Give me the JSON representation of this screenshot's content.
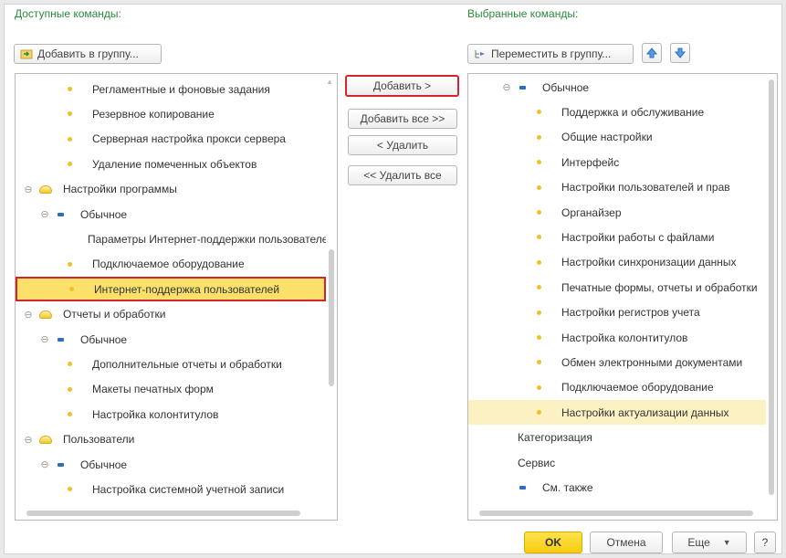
{
  "left": {
    "title": "Доступные команды:",
    "add_to_group": "Добавить в группу...",
    "rows": [
      {
        "level": 2,
        "icon": "dot",
        "label": "Регламентные и фоновые задания"
      },
      {
        "level": 2,
        "icon": "dot",
        "label": "Резервное копирование"
      },
      {
        "level": 2,
        "icon": "dot",
        "label": "Серверная настройка прокси сервера"
      },
      {
        "level": 2,
        "icon": "dot",
        "label": "Удаление помеченных объектов"
      },
      {
        "level": 0,
        "icon": "folder",
        "expander": "⊖",
        "label": "Настройки программы"
      },
      {
        "level": 1,
        "icon": "dash",
        "expander": "⊖",
        "label": "Обычное"
      },
      {
        "level": 2,
        "icon": "dot",
        "label": "Параметры Интернет-поддержки пользователей"
      },
      {
        "level": 2,
        "icon": "dot",
        "label": "Подключаемое оборудование"
      },
      {
        "level": 2,
        "icon": "dot",
        "label": "Интернет-поддержка пользователей",
        "state": "selected-box"
      },
      {
        "level": 0,
        "icon": "folder",
        "expander": "⊖",
        "label": "Отчеты и обработки"
      },
      {
        "level": 1,
        "icon": "dash",
        "expander": "⊖",
        "label": "Обычное"
      },
      {
        "level": 2,
        "icon": "dot",
        "label": "Дополнительные отчеты и обработки"
      },
      {
        "level": 2,
        "icon": "dot",
        "label": "Макеты печатных форм"
      },
      {
        "level": 2,
        "icon": "dot",
        "label": "Настройка колонтитулов"
      },
      {
        "level": 0,
        "icon": "folder",
        "expander": "⊖",
        "label": "Пользователи"
      },
      {
        "level": 1,
        "icon": "dash",
        "expander": "⊖",
        "label": "Обычное"
      },
      {
        "level": 2,
        "icon": "dot",
        "label": "Настройка системной учетной записи"
      }
    ]
  },
  "middle": {
    "add": "Добавить >",
    "add_all": "Добавить все >>",
    "remove": "< Удалить",
    "remove_all": "<< Удалить все"
  },
  "right": {
    "title": "Выбранные команды:",
    "move_to_group": "Переместить в группу...",
    "rows": [
      {
        "level": 1,
        "icon": "dash",
        "expander": "⊖",
        "label": "Обычное"
      },
      {
        "level": 2,
        "icon": "dot",
        "label": "Поддержка и обслуживание"
      },
      {
        "level": 2,
        "icon": "dot",
        "label": "Общие настройки"
      },
      {
        "level": 2,
        "icon": "dot",
        "label": "Интерфейс"
      },
      {
        "level": 2,
        "icon": "dot",
        "label": "Настройки пользователей и прав"
      },
      {
        "level": 2,
        "icon": "dot",
        "label": "Органайзер"
      },
      {
        "level": 2,
        "icon": "dot",
        "label": "Настройки работы с файлами"
      },
      {
        "level": 2,
        "icon": "dot",
        "label": "Настройки синхронизации данных"
      },
      {
        "level": 2,
        "icon": "dot",
        "label": "Печатные формы, отчеты и обработки"
      },
      {
        "level": 2,
        "icon": "dot",
        "label": "Настройки регистров учета"
      },
      {
        "level": 2,
        "icon": "dot",
        "label": "Настройка колонтитулов"
      },
      {
        "level": 2,
        "icon": "dot",
        "label": "Обмен электронными документами"
      },
      {
        "level": 2,
        "icon": "dot",
        "label": "Подключаемое оборудование"
      },
      {
        "level": 2,
        "icon": "dot",
        "label": "Настройки актуализации данных",
        "state": "light"
      },
      {
        "level": 0,
        "icon": "none",
        "label": "Категоризация"
      },
      {
        "level": 0,
        "icon": "none",
        "label": "Сервис"
      },
      {
        "level": 0,
        "icon": "dash",
        "label": "См. также"
      }
    ]
  },
  "footer": {
    "ok": "OK",
    "cancel": "Отмена",
    "more": "Еще",
    "help": "?"
  },
  "colors": {
    "accent_title": "#2a8a3a",
    "selection": "#fbe06a",
    "highlight_border": "#d4242b",
    "ok_button": "#f7cc12"
  }
}
